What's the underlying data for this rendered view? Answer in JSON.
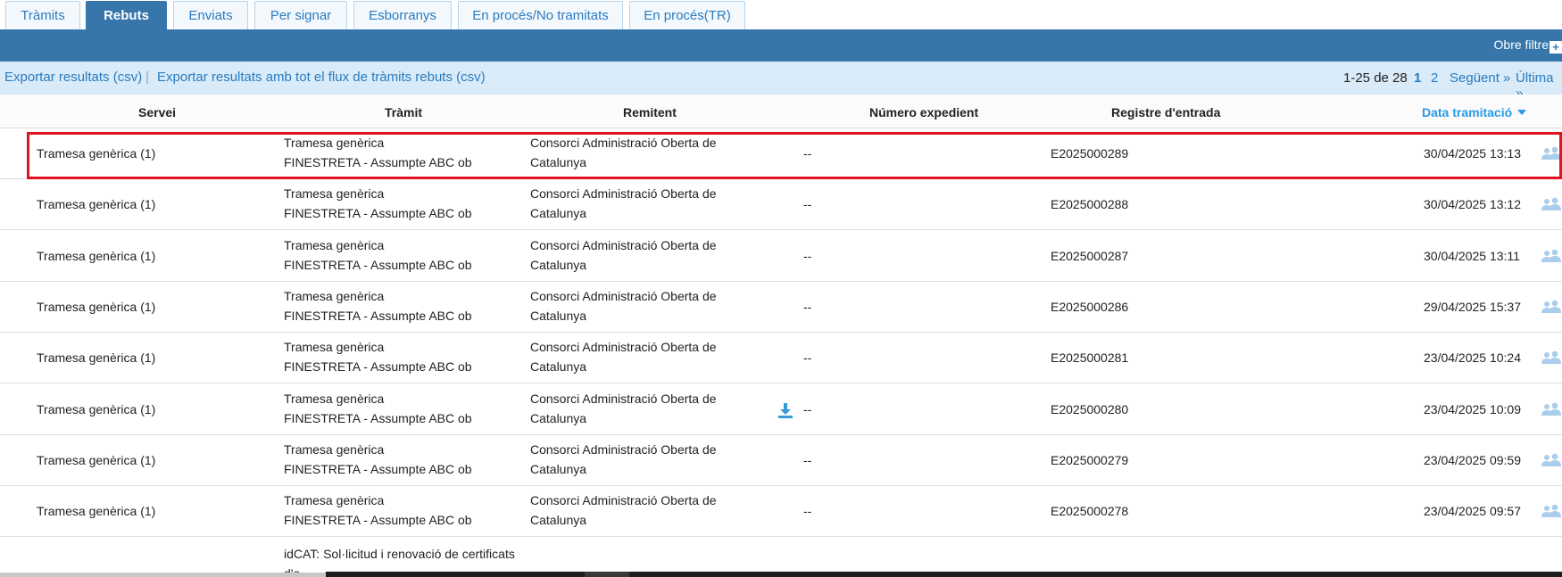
{
  "tabs": [
    {
      "label": "Tràmits"
    },
    {
      "label": "Rebuts"
    },
    {
      "label": "Enviats"
    },
    {
      "label": "Per signar"
    },
    {
      "label": "Esborranys"
    },
    {
      "label": "En procés/No tramitats"
    },
    {
      "label": "En procés(TR)"
    }
  ],
  "active_tab": "Rebuts",
  "toolbar": {
    "filter_label": "Obre filtre"
  },
  "exports": {
    "csv": "Exportar resultats (csv)",
    "separator": "|",
    "csv_flow": "Exportar resultats amb tot el flux de tràmits rebuts (csv)"
  },
  "pager": {
    "count": "1-25 de 28",
    "page1": "1",
    "page2": "2",
    "next": "Següent »",
    "last": "Última »"
  },
  "columns": {
    "servei": "Servei",
    "tramit": "Tràmit",
    "remitent": "Remitent",
    "numero": "Número expedient",
    "registre": "Registre d'entrada",
    "data": "Data tramitació"
  },
  "rows": [
    {
      "servei": "Tramesa genèrica  (1)",
      "tramit1": "Tramesa genèrica",
      "tramit2": "FINESTRETA - Assumpte ABC ob",
      "remitent1": "Consorci Administració Oberta de",
      "remitent2": "Catalunya",
      "numero": "--",
      "registre": "E2025000289",
      "data": "30/04/2025 13:13"
    },
    {
      "servei": "Tramesa genèrica  (1)",
      "tramit1": "Tramesa genèrica",
      "tramit2": "FINESTRETA - Assumpte ABC ob",
      "remitent1": "Consorci Administració Oberta de",
      "remitent2": "Catalunya",
      "numero": "--",
      "registre": "E2025000288",
      "data": "30/04/2025 13:12"
    },
    {
      "servei": "Tramesa genèrica  (1)",
      "tramit1": "Tramesa genèrica",
      "tramit2": "FINESTRETA - Assumpte ABC ob",
      "remitent1": "Consorci Administració Oberta de",
      "remitent2": "Catalunya",
      "numero": "--",
      "registre": "E2025000287",
      "data": "30/04/2025 13:11"
    },
    {
      "servei": "Tramesa genèrica  (1)",
      "tramit1": "Tramesa genèrica",
      "tramit2": "FINESTRETA - Assumpte ABC ob",
      "remitent1": "Consorci Administració Oberta de",
      "remitent2": "Catalunya",
      "numero": "--",
      "registre": "E2025000286",
      "data": "29/04/2025 15:37"
    },
    {
      "servei": "Tramesa genèrica  (1)",
      "tramit1": "Tramesa genèrica",
      "tramit2": "FINESTRETA - Assumpte ABC ob",
      "remitent1": "Consorci Administració Oberta de",
      "remitent2": "Catalunya",
      "numero": "--",
      "registre": "E2025000281",
      "data": "23/04/2025 10:24"
    },
    {
      "servei": "Tramesa genèrica  (1)",
      "tramit1": "Tramesa genèrica",
      "tramit2": "FINESTRETA - Assumpte ABC ob",
      "remitent1": "Consorci Administració Oberta de",
      "remitent2": "Catalunya",
      "numero": "--",
      "registre": "E2025000280",
      "data": "23/04/2025 10:09"
    },
    {
      "servei": "Tramesa genèrica  (1)",
      "tramit1": "Tramesa genèrica",
      "tramit2": "FINESTRETA - Assumpte ABC ob",
      "remitent1": "Consorci Administració Oberta de",
      "remitent2": "Catalunya",
      "numero": "--",
      "registre": "E2025000279",
      "data": "23/04/2025 09:59"
    },
    {
      "servei": "Tramesa genèrica  (1)",
      "tramit1": "Tramesa genèrica",
      "tramit2": "FINESTRETA - Assumpte ABC ob",
      "remitent1": "Consorci Administració Oberta de",
      "remitent2": "Catalunya",
      "numero": "--",
      "registre": "E2025000278",
      "data": "23/04/2025 09:57"
    }
  ],
  "partial_row": {
    "tramit1": "idCAT: Sol·licitud i renovació de certificats",
    "tramit2": "d'o..."
  },
  "icons": {
    "download": "download-icon",
    "users": "users-icon",
    "filter": "plus-icon",
    "sort": "sort-desc-icon"
  },
  "colors": {
    "primary": "#3776ab",
    "link": "#2a7bbf",
    "highlight": "#e0141e",
    "exportbar": "#d9ebf8"
  }
}
